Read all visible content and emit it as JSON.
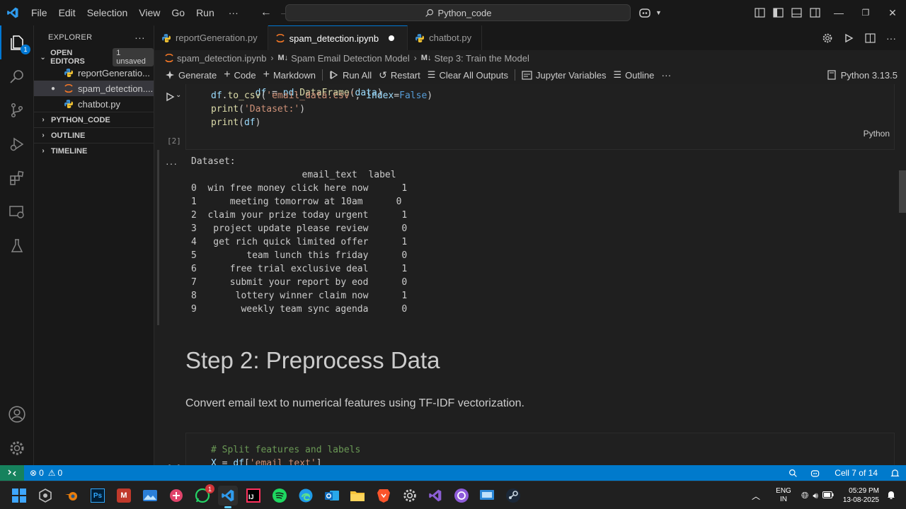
{
  "menu": {
    "items": [
      "File",
      "Edit",
      "Selection",
      "View",
      "Go",
      "Run"
    ],
    "more": "···"
  },
  "search": {
    "text": "Python_code"
  },
  "activity": {
    "badge": "1"
  },
  "explorer": {
    "title": "EXPLORER",
    "more": "···",
    "open_editors_label": "OPEN EDITORS",
    "unsaved_badge": "1 unsaved",
    "files": [
      "reportGeneratio...",
      "spam_detection....",
      "chatbot.py"
    ],
    "sections": [
      "PYTHON_CODE",
      "OUTLINE",
      "TIMELINE"
    ]
  },
  "tabs": [
    {
      "label": "reportGeneration.py"
    },
    {
      "label": "spam_detection.ipynb"
    },
    {
      "label": "chatbot.py"
    }
  ],
  "breadcrumb": {
    "file": "spam_detection.ipynb",
    "heading1": "Spam Email Detection Model",
    "heading2": "Step 3: Train the Model"
  },
  "toolbar": {
    "generate": "Generate",
    "code": "Code",
    "markdown": "Markdown",
    "run_all": "Run All",
    "restart": "Restart",
    "clear_outputs": "Clear All Outputs",
    "jupyter_vars": "Jupyter Variables",
    "outline": "Outline",
    "more": "···",
    "kernel": "Python 3.13.5"
  },
  "cell1": {
    "exec_count": "[2]",
    "language": "Python",
    "lines": [
      "df = pd.DataFrame(data)",
      "df.to_csv('email_data.csv', index=False)",
      "print('Dataset:')",
      "print(df)"
    ]
  },
  "output": {
    "more": "···",
    "text": "Dataset:\n                    email_text  label\n0  win free money click here now      1\n1      meeting tomorrow at 10am      0\n2  claim your prize today urgent      1\n3   project update please review      0\n4   get rich quick limited offer      1\n5         team lunch this friday      0\n6      free trial exclusive deal      1\n7      submit your report by eod      0\n8       lottery winner claim now      1\n9        weekly team sync agenda      0"
  },
  "markdown": {
    "heading": "Step 2: Preprocess Data",
    "paragraph": "Convert email text to numerical features using TF-IDF vectorization."
  },
  "cell2": {
    "lines": [
      "# Split features and labels",
      "X = df['email_text']"
    ]
  },
  "statusbar": {
    "errors": "0",
    "warnings": "0",
    "cell": "Cell 7 of 14"
  },
  "tray": {
    "lang1": "ENG",
    "lang2": "IN",
    "time": "05:29 PM",
    "date": "13-08-2025",
    "notif": "1"
  }
}
